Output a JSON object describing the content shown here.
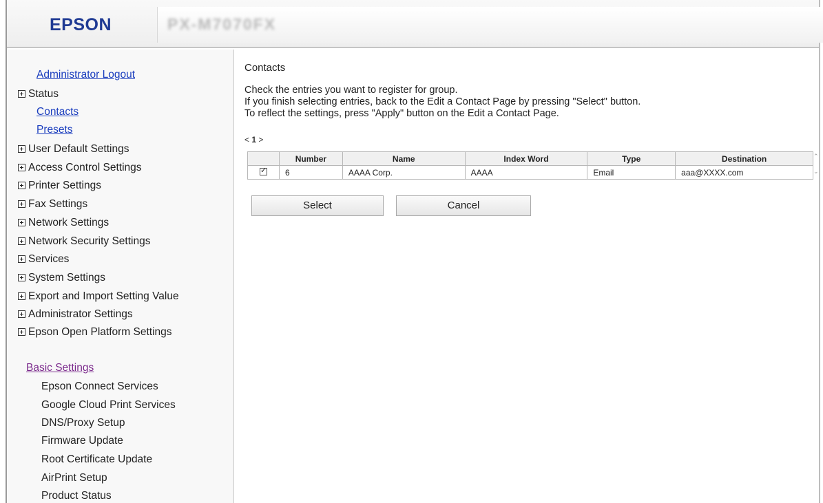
{
  "header": {
    "logo_text": "EPSON",
    "model_name": "PX-M7070FX"
  },
  "sidebar": {
    "admin_logout": "Administrator Logout",
    "status": "Status",
    "contacts": "Contacts",
    "presets": "Presets",
    "sections": [
      "User Default Settings",
      "Access Control Settings",
      "Printer Settings",
      "Fax Settings",
      "Network Settings",
      "Network Security Settings",
      "Services",
      "System Settings",
      "Export and Import Setting Value",
      "Administrator Settings",
      "Epson Open Platform Settings"
    ],
    "basic_settings": "Basic Settings",
    "basic_items": [
      "Epson Connect Services",
      "Google Cloud Print Services",
      "DNS/Proxy Setup",
      "Firmware Update",
      "Root Certificate Update",
      "AirPrint Setup",
      "Product Status"
    ]
  },
  "main": {
    "title": "Contacts",
    "instructions": [
      "Check the entries you want to register for group.",
      "If you finish selecting entries, back to the Edit a Contact Page by pressing \"Select\" button.",
      "To reflect the settings, press \"Apply\" button on the Edit a Contact Page."
    ],
    "pager": {
      "prev": "<",
      "current": "1",
      "next": ">"
    },
    "table": {
      "headers": [
        "",
        "Number",
        "Name",
        "Index Word",
        "Type",
        "Destination"
      ],
      "rows": [
        {
          "checked": true,
          "number": "6",
          "name": "AAAA Corp.",
          "index_word": "AAAA",
          "type": "Email",
          "destination": "aaa@XXXX.com"
        }
      ]
    },
    "buttons": {
      "select": "Select",
      "cancel": "Cancel"
    }
  },
  "colors": {
    "link_blue": "#1a3dbe",
    "link_purple": "#7b2a8c",
    "logo_blue": "#1f3a93"
  }
}
